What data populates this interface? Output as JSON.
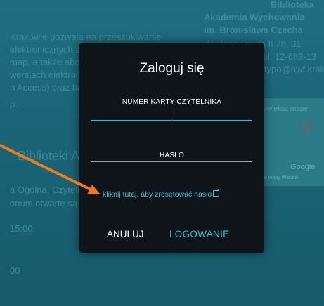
{
  "background": {
    "intro_lines": [
      "Krakowie pozwala na przeszukiwanie",
      "elektronicznych zasobów bibliotecznych,",
      "map, a także abonowanych baz",
      "wersjach elektronicznych, czasopism",
      "n Access) oraz baz do",
      "p."
    ],
    "section_title": "Biblioteki AWF Kraków",
    "info_lines": [
      "a Ogólna, Czytelnia",
      "onum otwarte są w godzinach:"
    ],
    "times": [
      "15:00",
      "00"
    ],
    "address_lines": [
      "Biblioteka",
      "Akademia Wychowania",
      "im. Bronisława Czecha",
      "Al. Jana Pawła II 78, 31",
      "tel. 12-683-13",
      "typo@awf.krak"
    ],
    "map": {
      "enlarge_link": "Powiększ mapę",
      "google": "Google",
      "footer": "Dane mapy   Warunki"
    }
  },
  "modal": {
    "title": "Zaloguj się",
    "card_number_label": "NUMER KARTY CZYTELNIKA",
    "card_number_value": "",
    "password_label": "HASŁO",
    "password_value": "",
    "reset_link": "kliknij tutaj, aby zresetować hasło",
    "cancel_label": "ANULUJ",
    "login_label": "LOGOWANIE"
  },
  "colors": {
    "accent": "#36c1d6",
    "modal_bg": "#0f1418",
    "annotation_arrow": "#f07a1a"
  },
  "icons": {
    "external_link": "external-link-icon",
    "map_pin": "map-pin-icon",
    "annotation_arrow": "orange-arrow"
  }
}
